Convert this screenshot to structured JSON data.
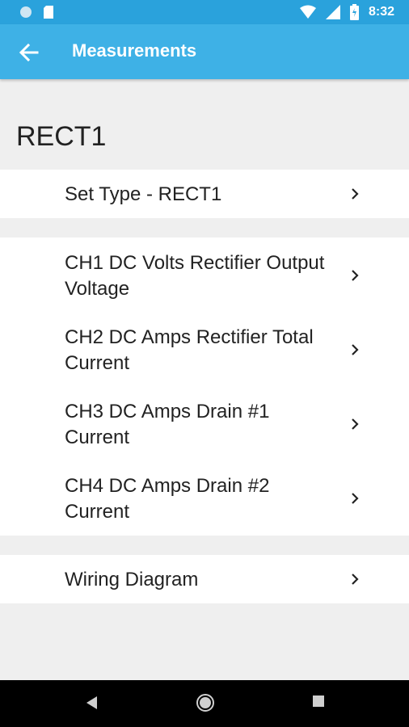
{
  "status_bar": {
    "time": "8:32",
    "icons": [
      "circle-notification-icon",
      "sd-card-icon",
      "wifi-icon",
      "cell-signal-icon",
      "battery-icon"
    ]
  },
  "app_bar": {
    "title": "Measurements",
    "back_icon": "arrow-back-icon"
  },
  "section": {
    "title": "RECT1"
  },
  "groups": [
    {
      "items": [
        {
          "label": "Set Type - RECT1"
        }
      ]
    },
    {
      "items": [
        {
          "label": "CH1 DC Volts Rectifier Output Voltage"
        },
        {
          "label": "CH2 DC Amps Rectifier Total Current"
        },
        {
          "label": "CH3 DC Amps Drain #1 Current"
        },
        {
          "label": "CH4 DC Amps Drain #2 Current"
        }
      ]
    },
    {
      "items": [
        {
          "label": "Wiring Diagram"
        }
      ]
    }
  ],
  "colors": {
    "status_bar": "#2aa2dc",
    "app_bar": "#3eb1e6",
    "background": "#efefef",
    "card": "#ffffff",
    "text": "#222222"
  },
  "nav_bar": {
    "icons": [
      "back-triangle-icon",
      "home-circle-icon",
      "recents-square-icon"
    ]
  }
}
